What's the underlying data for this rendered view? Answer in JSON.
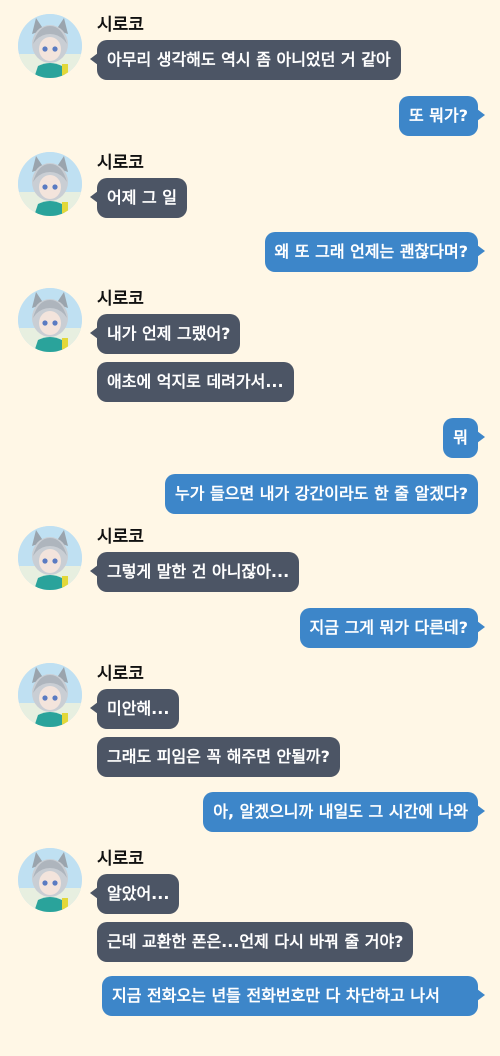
{
  "contact": {
    "name": "시로코",
    "avatar_icon": "character-avatar-icon"
  },
  "messages": [
    {
      "sender": "시로코",
      "text": "아무리 생각해도 역시 좀 아니었던 거 같아"
    },
    {
      "sender": "me",
      "text": "또 뭐가?"
    },
    {
      "sender": "시로코",
      "text": "어제 그 일"
    },
    {
      "sender": "me",
      "text": "왜 또 그래 언제는 괜찮다며?"
    },
    {
      "sender": "시로코",
      "text": "내가 언제 그랬어?"
    },
    {
      "sender": "시로코",
      "text": "애초에 억지로 데려가서..."
    },
    {
      "sender": "me",
      "text": "뭐"
    },
    {
      "sender": "me",
      "text": "누가 들으면 내가 강간이라도 한 줄 알겠다?"
    },
    {
      "sender": "시로코",
      "text": "그렇게 말한 건 아니잖아..."
    },
    {
      "sender": "me",
      "text": "지금 그게 뭐가 다른데?"
    },
    {
      "sender": "시로코",
      "text": "미안해..."
    },
    {
      "sender": "시로코",
      "text": "그래도 피임은 꼭 해주면 안될까?"
    },
    {
      "sender": "me",
      "text": "아, 알겠으니까 내일도 그 시간에 나와"
    },
    {
      "sender": "시로코",
      "text": "알았어..."
    },
    {
      "sender": "시로코",
      "text": "근데 교환한 폰은...언제 다시 바꿔 줄 거야?"
    },
    {
      "sender": "me",
      "text": "지금 전화오는 년들 전화번호만 다 차단하고 나서"
    }
  ],
  "colors": {
    "background": "#fff7e6",
    "incoming_bubble": "#4c5565",
    "outgoing_bubble": "#3d86c9",
    "bubble_text": "#ffffff"
  }
}
